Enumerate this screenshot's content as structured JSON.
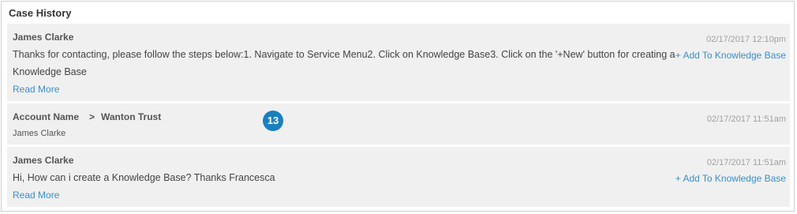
{
  "panel": {
    "title": "Case History"
  },
  "entries": [
    {
      "author": "James Clarke",
      "timestamp": "02/17/2017 12:10pm",
      "message_line1": "Thanks for contacting, please follow the steps below:1. Navigate to Service Menu2. Click on Knowledge Base3. Click on the '+New' button for creating a",
      "message_line2": "Knowledge Base",
      "read_more": "Read More",
      "add_to_kb": "+ Add To Knowledge Base"
    },
    {
      "account_label": "Account Name",
      "separator": ">",
      "account_value": "Wanton Trust",
      "sub_user": "James Clarke",
      "timestamp": "02/17/2017 11:51am"
    },
    {
      "author": "James Clarke",
      "timestamp": "02/17/2017 11:51am",
      "message": "Hi, How can i create a Knowledge Base? Thanks Francesca",
      "read_more": "Read More",
      "add_to_kb": "+ Add To Knowledge Base"
    }
  ],
  "badge": {
    "number": "13",
    "color": "#1a7fc0"
  },
  "colors": {
    "link": "#3d8fc4",
    "entry_bg": "#f0f0f0",
    "timestamp": "#a0a0a0"
  }
}
